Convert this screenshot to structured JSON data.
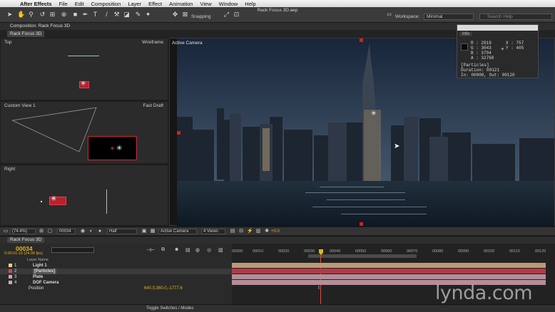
{
  "menubar": {
    "app_name": "After Effects",
    "items": [
      "File",
      "Edit",
      "Composition",
      "Layer",
      "Effect",
      "Animation",
      "View",
      "Window",
      "Help"
    ]
  },
  "toolbar": {
    "document_title": "Rack Focus 3D.aep",
    "snapping_label": "Snapping",
    "workspace_label": "Workspace:",
    "workspace_value": "Minimal",
    "search_help_placeholder": "Search Help"
  },
  "composition_panel": {
    "tab_label": "Composition: Rack Focus 3D",
    "subtab_label": "Rack Focus 3D",
    "views": [
      {
        "name": "Top",
        "renderer": "Wireframe"
      },
      {
        "name": "Custom View 1",
        "renderer": "Fast Draft"
      },
      {
        "name": "Right",
        "renderer": ""
      }
    ],
    "main_view_label": "Active Camera"
  },
  "info_panel": {
    "tab_label": "Info",
    "r": "R : 2819",
    "g": "G : 3043",
    "b": "B : 3794",
    "a": "A : 32768",
    "x": "X : 757",
    "y": "Y : 405",
    "layer_name": "[Particles]",
    "duration": "Duration: 00121",
    "in_out": "In: 00000, Out: 00120"
  },
  "comp_footer": {
    "zoom": "(74.4%)",
    "frame": "00034",
    "resolution": "Half",
    "camera": "Active Camera",
    "view_layout": "4 Views",
    "exposure": "+0.0"
  },
  "timeline": {
    "tab_label": "Rack Focus 3D",
    "timecode": "00034",
    "fps": "0:00:01:10 (24.00 fps)",
    "column_header": "Layer Name",
    "ruler": [
      "00000",
      "00010",
      "00020",
      "00030",
      "00040",
      "00050",
      "00060",
      "00070",
      "00080",
      "00090",
      "00100",
      "00110",
      "00120"
    ],
    "layers": [
      {
        "num": "1",
        "name": "Light 1",
        "color": "#e8d27a",
        "bar_color": "#b99a74"
      },
      {
        "num": "2",
        "name": "[Particles]",
        "color": "#c84b5a",
        "bar_color": "#b13a48"
      },
      {
        "num": "3",
        "name": "Plate",
        "color": "#c9a9b3",
        "bar_color": "#b48e99"
      },
      {
        "num": "4",
        "name": "DOF Camera",
        "color": "#c9a9b3",
        "bar_color": "#b48e99"
      }
    ],
    "property_name": "Position",
    "property_value": "640.0,360.0,-1777.6",
    "toggle_label": "Toggle Switches / Modes"
  },
  "watermark": "lynda.com"
}
